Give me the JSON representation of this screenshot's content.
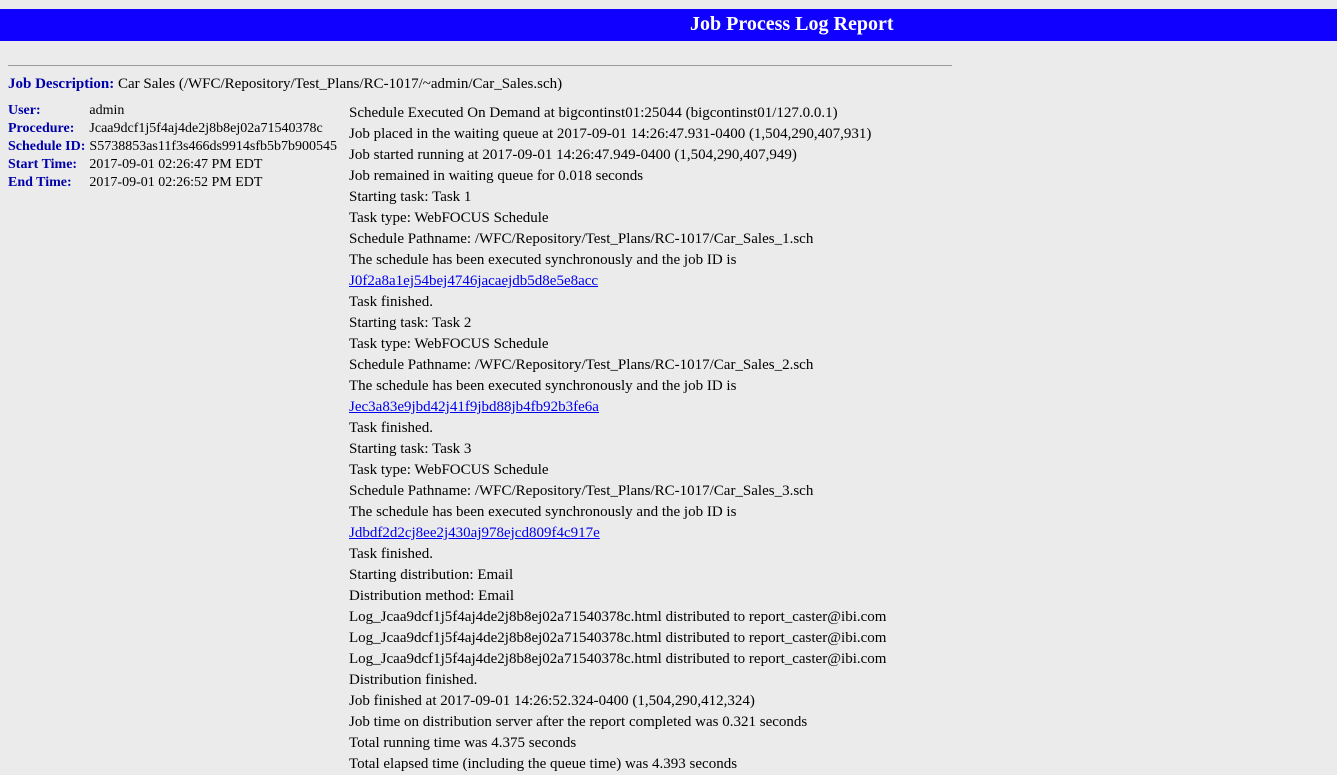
{
  "banner": {
    "title": "Job Process Log Report"
  },
  "description": {
    "label": "Job Description:",
    "value": "Car Sales (/WFC/Repository/Test_Plans/RC-1017/~admin/Car_Sales.sch)"
  },
  "meta": {
    "user_label": "User:",
    "user_value": "admin",
    "procedure_label": "Procedure:",
    "procedure_value": "Jcaa9dcf1j5f4aj4de2j8b8ej02a71540378c",
    "schedule_id_label": "Schedule ID:",
    "schedule_id_value": "S5738853as11f3s466ds9914sfb5b7b900545",
    "start_time_label": "Start Time:",
    "start_time_value": "2017-09-01 02:26:47 PM EDT",
    "end_time_label": "End Time:",
    "end_time_value": "2017-09-01 02:26:52 PM EDT"
  },
  "log": [
    {
      "text": "Schedule Executed On Demand at bigcontinst01:25044 (bigcontinst01/127.0.0.1)"
    },
    {
      "text": "Job placed in the waiting queue at 2017-09-01 14:26:47.931-0400 (1,504,290,407,931)"
    },
    {
      "text": "Job started running at 2017-09-01 14:26:47.949-0400 (1,504,290,407,949)"
    },
    {
      "text": "Job remained in waiting queue for 0.018 seconds"
    },
    {
      "text": "Starting task: Task 1"
    },
    {
      "text": "Task type: WebFOCUS Schedule"
    },
    {
      "text": "Schedule Pathname: /WFC/Repository/Test_Plans/RC-1017/Car_Sales_1.sch"
    },
    {
      "text": "The schedule has been executed synchronously and the job ID is ",
      "link": "J0f2a8a1ej54bej4746jacaejdb5d8e5e8acc"
    },
    {
      "text": "Task finished."
    },
    {
      "text": "Starting task: Task 2"
    },
    {
      "text": "Task type: WebFOCUS Schedule"
    },
    {
      "text": "Schedule Pathname: /WFC/Repository/Test_Plans/RC-1017/Car_Sales_2.sch"
    },
    {
      "text": "The schedule has been executed synchronously and the job ID is ",
      "link": "Jec3a83e9jbd42j41f9jbd88jb4fb92b3fe6a"
    },
    {
      "text": "Task finished."
    },
    {
      "text": "Starting task: Task 3"
    },
    {
      "text": "Task type: WebFOCUS Schedule"
    },
    {
      "text": "Schedule Pathname: /WFC/Repository/Test_Plans/RC-1017/Car_Sales_3.sch"
    },
    {
      "text": "The schedule has been executed synchronously and the job ID is ",
      "link": "Jdbdf2d2cj8ee2j430aj978ejcd809f4c917e"
    },
    {
      "text": "Task finished."
    },
    {
      "text": "Starting distribution: Email"
    },
    {
      "text": "Distribution method: Email"
    },
    {
      "text": "Log_Jcaa9dcf1j5f4aj4de2j8b8ej02a71540378c.html distributed to report_caster@ibi.com"
    },
    {
      "text": "Log_Jcaa9dcf1j5f4aj4de2j8b8ej02a71540378c.html distributed to report_caster@ibi.com"
    },
    {
      "text": "Log_Jcaa9dcf1j5f4aj4de2j8b8ej02a71540378c.html distributed to report_caster@ibi.com"
    },
    {
      "text": "Distribution finished."
    },
    {
      "text": "Job finished at 2017-09-01 14:26:52.324-0400 (1,504,290,412,324)"
    },
    {
      "text": "Job time on distribution server after the report completed was 0.321 seconds"
    },
    {
      "text": "Total running time was 4.375 seconds"
    },
    {
      "text": "Total elapsed time (including the queue time) was 4.393 seconds"
    }
  ]
}
